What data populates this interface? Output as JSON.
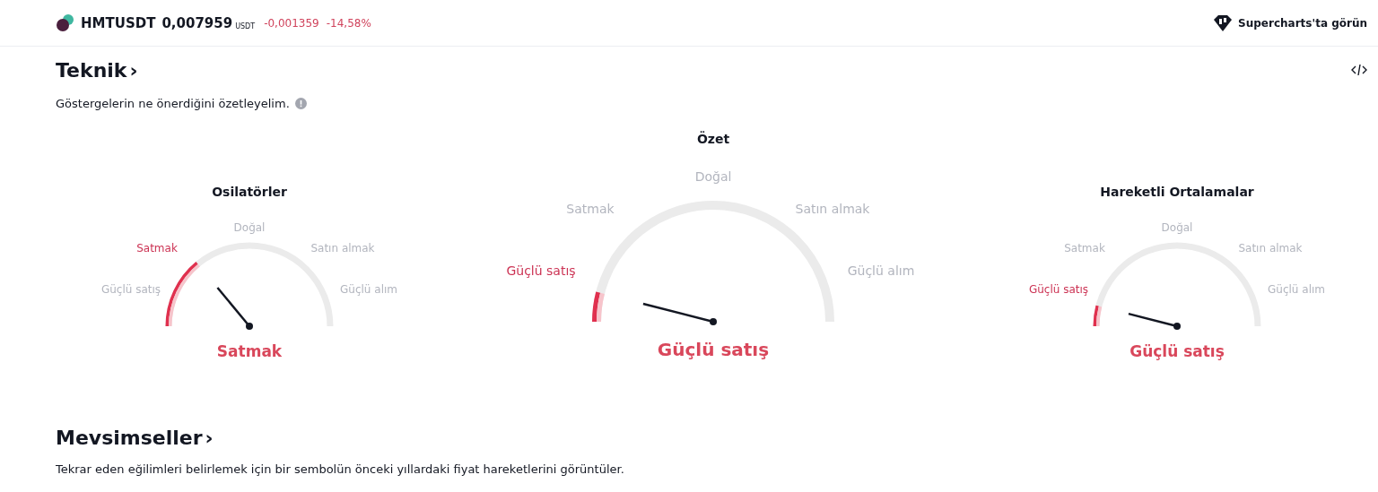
{
  "header": {
    "symbol": "HMTUSDT",
    "price": "0,007959",
    "currency": "USDT",
    "change": "-0,001359",
    "change_percent": "-14,58%",
    "link": "Supercharts'ta görün"
  },
  "technical": {
    "title": "Teknik",
    "chevron": "›",
    "subtitle": "Göstergelerin ne önerdiğini özetleyelim.",
    "gauges": [
      {
        "kind": "small",
        "title": "Osilatörler",
        "result": "Satmak",
        "labels": [
          {
            "text": "Güçlü satış",
            "selected": false
          },
          {
            "text": "Satmak",
            "selected": true
          },
          {
            "text": "Doğal",
            "selected": false
          },
          {
            "text": "Satın almak",
            "selected": false
          },
          {
            "text": "Güçlü alım",
            "selected": false
          }
        ]
      },
      {
        "kind": "large",
        "title": "Özet",
        "result": "Güçlü satış",
        "labels": [
          {
            "text": "Güçlü satış",
            "selected": true
          },
          {
            "text": "Satmak",
            "selected": false
          },
          {
            "text": "Doğal",
            "selected": false
          },
          {
            "text": "Satın almak",
            "selected": false
          },
          {
            "text": "Güçlü alım",
            "selected": false
          }
        ]
      },
      {
        "kind": "small",
        "title": "Hareketli Ortalamalar",
        "result": "Güçlü satış",
        "labels": [
          {
            "text": "Güçlü satış",
            "selected": true
          },
          {
            "text": "Satmak",
            "selected": false
          },
          {
            "text": "Doğal",
            "selected": false
          },
          {
            "text": "Satın almak",
            "selected": false
          },
          {
            "text": "Güçlü alım",
            "selected": false
          }
        ]
      }
    ]
  },
  "seasonals": {
    "title": "Mevsimseller",
    "chevron": "›",
    "subtitle": "Tekrar eden eğilimleri belirlemek için bir sembolün önceki yıllardaki fiyat hareketlerini görüntüler."
  }
}
